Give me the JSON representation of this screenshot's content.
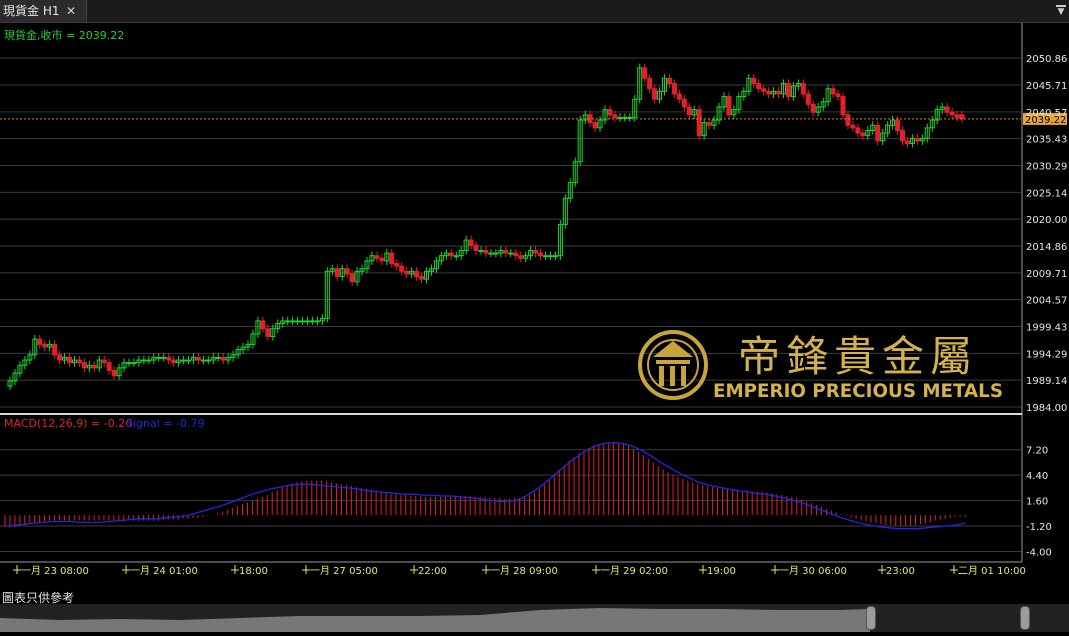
{
  "tab": {
    "title": "現貨金 H1",
    "close": "✕"
  },
  "menu_icon": "dropdown-menu-icon",
  "footer_note": "圖表只供參考",
  "watermark": {
    "zh": "帝鋒貴金屬",
    "en": "EMPERIO PRECIOUS METALS",
    "logo": "emperio-logo-icon"
  },
  "colors": {
    "up": "#1fd12f",
    "down": "#e0202a",
    "macd": "#e0202a",
    "signal": "#2424e8",
    "price_line": "#d08a2a",
    "grid": "#3b3b3b",
    "axis_text": "#e6e6e6"
  },
  "chart_data": [
    {
      "type": "candlestick",
      "title": "現貨金,收市 = 2039.22",
      "last_price": "2039.22",
      "ylim": [
        1984.0,
        2053.0
      ],
      "yticks": [
        "2050.86",
        "2045.71",
        "2040.57",
        "2035.43",
        "2030.29",
        "2025.14",
        "2020.00",
        "2014.86",
        "2009.71",
        "2004.57",
        "1999.43",
        "1994.29",
        "1989.14",
        "1984.00"
      ],
      "xticks": [
        "一月 23 08:00",
        "一月 24 01:00",
        "18:00",
        "一月 27 05:00",
        "22:00",
        "一月 28 09:00",
        "一月 29 02:00",
        "19:00",
        "一月 30 06:00",
        "23:00",
        "二月 01 10:00"
      ],
      "close": [
        1989.0,
        1990.5,
        1992.0,
        1993.0,
        1994.0,
        1997.0,
        1996.0,
        1995.5,
        1996.0,
        1994.0,
        1993.0,
        1993.5,
        1992.5,
        1993.0,
        1992.5,
        1991.5,
        1992.0,
        1991.5,
        1993.0,
        1992.5,
        1991.0,
        1990.0,
        1991.5,
        1992.5,
        1992.5,
        1992.5,
        1993.0,
        1993.0,
        1993.0,
        1993.5,
        1993.5,
        1993.5,
        1993.0,
        1992.5,
        1993.0,
        1993.0,
        1993.0,
        1993.5,
        1993.0,
        1993.0,
        1993.0,
        1993.5,
        1993.5,
        1993.0,
        1993.5,
        1994.0,
        1995.0,
        1995.5,
        1996.0,
        1998.0,
        2000.5,
        1999.0,
        1997.5,
        1999.0,
        2000.0,
        2000.5,
        2000.5,
        2000.5,
        2000.5,
        2000.5,
        2000.5,
        2000.5,
        2000.5,
        2001.0,
        2010.0,
        2010.5,
        2009.0,
        2010.5,
        2009.5,
        2008.0,
        2010.0,
        2010.5,
        2012.0,
        2013.0,
        2012.5,
        2012.0,
        2013.5,
        2011.5,
        2011.0,
        2010.0,
        2009.5,
        2010.0,
        2009.0,
        2008.5,
        2010.0,
        2010.5,
        2012.0,
        2013.0,
        2013.5,
        2013.0,
        2013.0,
        2014.0,
        2016.0,
        2015.0,
        2014.0,
        2014.0,
        2013.5,
        2013.5,
        2013.5,
        2014.0,
        2013.5,
        2013.5,
        2013.0,
        2012.5,
        2013.0,
        2014.0,
        2013.5,
        2013.0,
        2013.0,
        2013.0,
        2013.0,
        2019.0,
        2024.0,
        2027.0,
        2031.0,
        2039.0,
        2040.0,
        2038.5,
        2037.5,
        2039.0,
        2041.0,
        2040.0,
        2039.5,
        2039.5,
        2039.5,
        2039.5,
        2043.0,
        2049.0,
        2047.0,
        2045.0,
        2043.0,
        2044.5,
        2047.0,
        2046.0,
        2044.0,
        2043.0,
        2041.5,
        2040.0,
        2041.0,
        2036.0,
        2038.5,
        2038.0,
        2039.0,
        2041.5,
        2043.5,
        2040.0,
        2041.0,
        2043.5,
        2044.5,
        2047.0,
        2046.0,
        2045.0,
        2044.5,
        2044.0,
        2044.5,
        2044.0,
        2046.0,
        2043.5,
        2045.5,
        2046.0,
        2044.0,
        2042.0,
        2040.5,
        2041.5,
        2042.5,
        2045.0,
        2044.0,
        2043.5,
        2040.0,
        2038.0,
        2037.5,
        2036.5,
        2036.0,
        2037.0,
        2038.0,
        2035.0,
        2036.5,
        2038.0,
        2039.0,
        2037.0,
        2035.0,
        2034.5,
        2035.5,
        2035.0,
        2035.5,
        2037.5,
        2039.0,
        2041.0,
        2041.5,
        2040.5,
        2040.0,
        2039.5,
        2039.22
      ],
      "last_bar_open": 2040.0
    },
    {
      "type": "bar",
      "title": "MACD(12,26,9) = -0.20",
      "signal_title": "Signal = -0.79",
      "ylim": [
        -4.5,
        8.6
      ],
      "yticks": [
        "7.20",
        "4.40",
        "1.60",
        "-1.20",
        "-4.00"
      ],
      "macd": [
        -1.3,
        -1.4,
        -1.3,
        -1.2,
        -1.1,
        -1.0,
        -0.9,
        -0.8,
        -0.7,
        -0.6,
        -0.6,
        -0.6,
        -0.6,
        -0.6,
        -0.6,
        -0.6,
        -0.6,
        -0.6,
        -0.6,
        -0.6,
        -0.6,
        -0.6,
        -0.7,
        -0.7,
        -0.7,
        -0.6,
        -0.6,
        -0.6,
        -0.6,
        -0.6,
        -0.6,
        -0.6,
        -0.5,
        -0.5,
        -0.5,
        -0.5,
        -0.4,
        -0.4,
        -0.3,
        -0.3,
        -0.2,
        -0.1,
        0.0,
        0.2,
        0.4,
        0.6,
        0.8,
        1.0,
        1.2,
        1.4,
        1.6,
        1.8,
        2.0,
        2.2,
        2.5,
        2.8,
        3.1,
        3.3,
        3.5,
        3.6,
        3.7,
        3.8,
        3.8,
        3.8,
        3.8,
        3.7,
        3.6,
        3.5,
        3.4,
        3.3,
        3.2,
        3.1,
        3.0,
        2.9,
        2.8,
        2.6,
        2.5,
        2.4,
        2.3,
        2.3,
        2.2,
        2.2,
        2.1,
        2.1,
        2.1,
        2.0,
        2.0,
        2.0,
        2.0,
        2.0,
        2.0,
        2.0,
        2.1,
        2.1,
        2.1,
        2.0,
        2.0,
        2.0,
        1.9,
        1.9,
        1.9,
        1.8,
        1.8,
        1.9,
        1.9,
        2.0,
        2.2,
        2.5,
        2.9,
        3.4,
        3.9,
        4.4,
        5.0,
        5.5,
        6.0,
        6.4,
        6.8,
        7.1,
        7.4,
        7.7,
        7.8,
        7.9,
        8.0,
        8.0,
        7.9,
        7.8,
        7.6,
        7.3,
        7.0,
        6.6,
        6.2,
        5.8,
        5.4,
        5.0,
        4.7,
        4.4,
        4.2,
        4.0,
        3.8,
        3.6,
        3.4,
        3.3,
        3.2,
        3.1,
        3.0,
        2.9,
        2.9,
        2.8,
        2.8,
        2.7,
        2.7,
        2.6,
        2.6,
        2.6,
        2.5,
        2.4,
        2.3,
        2.2,
        2.1,
        2.0,
        1.9,
        1.7,
        1.5,
        1.3,
        1.1,
        0.9,
        0.7,
        0.5,
        0.3,
        0.1,
        -0.1,
        -0.3,
        -0.4,
        -0.6,
        -0.7,
        -0.8,
        -0.9,
        -1.0,
        -1.1,
        -1.1,
        -1.2,
        -1.2,
        -1.2,
        -1.2,
        -1.1,
        -1.0,
        -0.9,
        -0.8,
        -0.6,
        -0.5,
        -0.4,
        -0.3,
        -0.2,
        -0.2,
        -0.2
      ],
      "signal": [
        -1.2,
        -1.1,
        -1.0,
        -0.9,
        -0.8,
        -0.7,
        -0.7,
        -0.7,
        -0.8,
        -0.8,
        -0.8,
        -0.7,
        -0.6,
        -0.5,
        -0.4,
        -0.4,
        -0.4,
        -0.3,
        -0.2,
        -0.1,
        0.2,
        0.5,
        0.8,
        1.1,
        1.5,
        1.9,
        2.3,
        2.6,
        2.9,
        3.1,
        3.3,
        3.4,
        3.4,
        3.3,
        3.2,
        3.1,
        3.0,
        2.9,
        2.7,
        2.6,
        2.5,
        2.4,
        2.3,
        2.3,
        2.2,
        2.2,
        2.1,
        2.1,
        2.0,
        1.9,
        1.8,
        1.6,
        1.5,
        1.5,
        1.7,
        2.2,
        2.9,
        3.7,
        4.6,
        5.5,
        6.3,
        7.0,
        7.6,
        7.9,
        8.0,
        7.9,
        7.6,
        7.1,
        6.5,
        5.8,
        5.2,
        4.6,
        4.1,
        3.6,
        3.3,
        3.1,
        2.9,
        2.7,
        2.6,
        2.4,
        2.3,
        2.1,
        1.9,
        1.6,
        1.3,
        0.9,
        0.5,
        0.1,
        -0.3,
        -0.6,
        -0.9,
        -1.1,
        -1.3,
        -1.4,
        -1.5,
        -1.5,
        -1.5,
        -1.4,
        -1.3,
        -1.2,
        -1.1,
        -0.9
      ]
    }
  ]
}
